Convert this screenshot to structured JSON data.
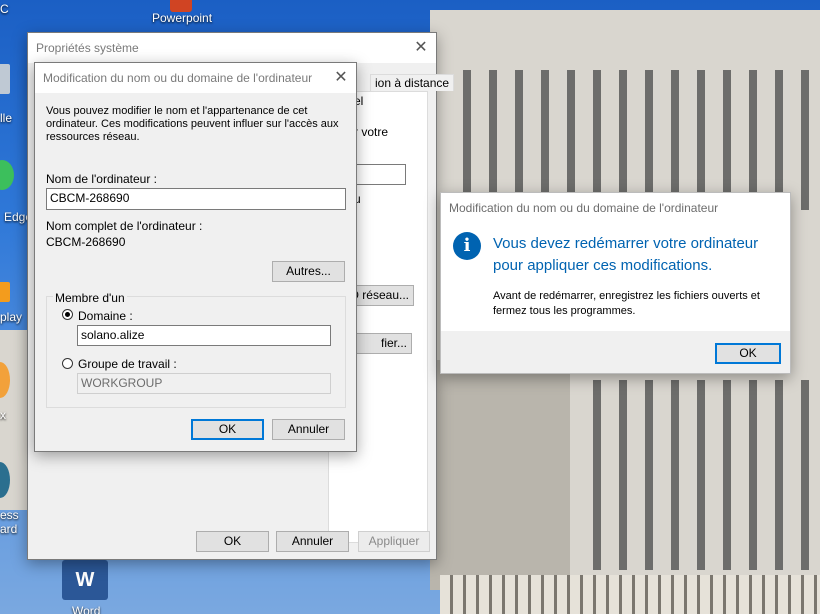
{
  "desktop": {
    "icons": [
      {
        "label": "Powerpoint"
      },
      {
        "label": "C"
      },
      {
        "label": "lle"
      },
      {
        "label": "Edge"
      },
      {
        "label": "play"
      },
      {
        "label": "x"
      },
      {
        "label": "ess"
      },
      {
        "label": "ard"
      },
      {
        "label": "Word"
      }
    ]
  },
  "sysprops": {
    "title": "Propriétés système",
    "tab_partial_1": "ion à distance",
    "tab_partial_2": "el",
    "text_partial_1": "r votre",
    "text_partial_2": "u",
    "btn_network_partial": "ID réseau...",
    "btn_modify_partial": "fier...",
    "ok": "OK",
    "cancel": "Annuler",
    "apply": "Appliquer"
  },
  "rename": {
    "title": "Modification du nom ou du domaine de l'ordinateur",
    "description": "Vous pouvez modifier le nom et l'appartenance de cet ordinateur. Ces modifications peuvent influer sur l'accès aux ressources réseau.",
    "computer_name_label": "Nom de l'ordinateur :",
    "computer_name_value": "CBCM-268690",
    "full_name_label": "Nom complet de l'ordinateur :",
    "full_name_value": "CBCM-268690",
    "more_button": "Autres...",
    "member_of_label": "Membre d'un",
    "domain_label": "Domaine :",
    "domain_value": "solano.alize",
    "workgroup_label": "Groupe de travail :",
    "workgroup_value": "WORKGROUP",
    "ok": "OK",
    "cancel": "Annuler"
  },
  "restart": {
    "title": "Modification du nom ou du domaine de l'ordinateur",
    "heading": "Vous devez redémarrer votre ordinateur pour appliquer ces modifications.",
    "body": "Avant de redémarrer, enregistrez les fichiers ouverts et fermez tous les programmes.",
    "ok": "OK",
    "icon": "info-icon",
    "accent": "#0063b1"
  }
}
